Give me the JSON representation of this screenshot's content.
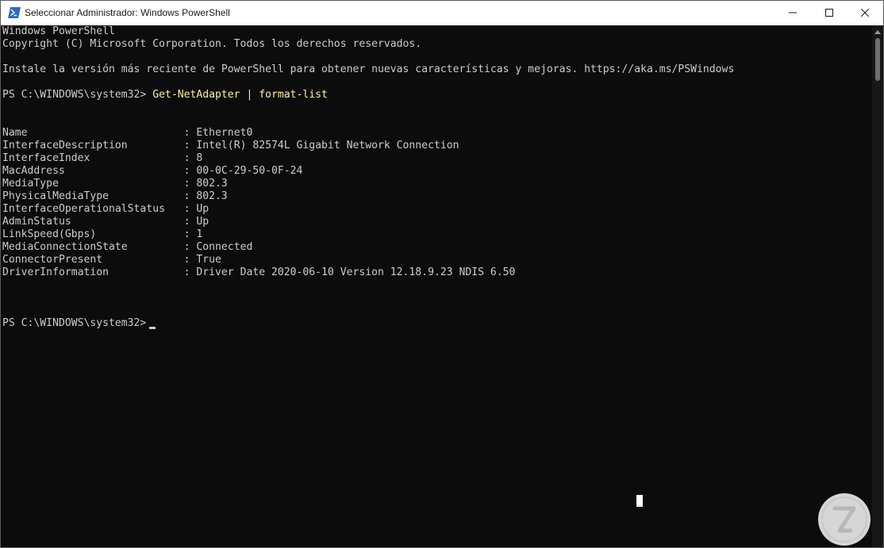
{
  "window": {
    "title": "Seleccionar Administrador: Windows PowerShell",
    "icon": "powershell-icon"
  },
  "caption_buttons": {
    "minimize_icon": "minimize-icon",
    "maximize_icon": "maximize-icon",
    "close_icon": "close-icon"
  },
  "console": {
    "header_line1": "Windows PowerShell",
    "header_line2": "Copyright (C) Microsoft Corporation. Todos los derechos reservados.",
    "update_notice": "Instale la versión más reciente de PowerShell para obtener nuevas características y mejoras. https://aka.ms/PSWindows",
    "prompt1": "PS C:\\WINDOWS\\system32>",
    "command1": "Get-NetAdapter | format-list",
    "properties": [
      {
        "name": "Name                         ",
        "value": ": Ethernet0"
      },
      {
        "name": "InterfaceDescription         ",
        "value": ": Intel(R) 82574L Gigabit Network Connection"
      },
      {
        "name": "InterfaceIndex               ",
        "value": ": 8"
      },
      {
        "name": "MacAddress                   ",
        "value": ": 00-0C-29-50-0F-24"
      },
      {
        "name": "MediaType                    ",
        "value": ": 802.3"
      },
      {
        "name": "PhysicalMediaType            ",
        "value": ": 802.3"
      },
      {
        "name": "InterfaceOperationalStatus   ",
        "value": ": Up"
      },
      {
        "name": "AdminStatus                  ",
        "value": ": Up"
      },
      {
        "name": "LinkSpeed(Gbps)              ",
        "value": ": 1"
      },
      {
        "name": "MediaConnectionState         ",
        "value": ": Connected"
      },
      {
        "name": "ConnectorPresent             ",
        "value": ": True"
      },
      {
        "name": "DriverInformation            ",
        "value": ": Driver Date 2020-06-10 Version 12.18.9.23 NDIS 6.50"
      }
    ],
    "prompt2": "PS C:\\WINDOWS\\system32>"
  },
  "colors": {
    "background": "#0c0c0c",
    "foreground": "#cccccc",
    "command": "#f9f1a5",
    "titlebar": "#ffffff"
  }
}
